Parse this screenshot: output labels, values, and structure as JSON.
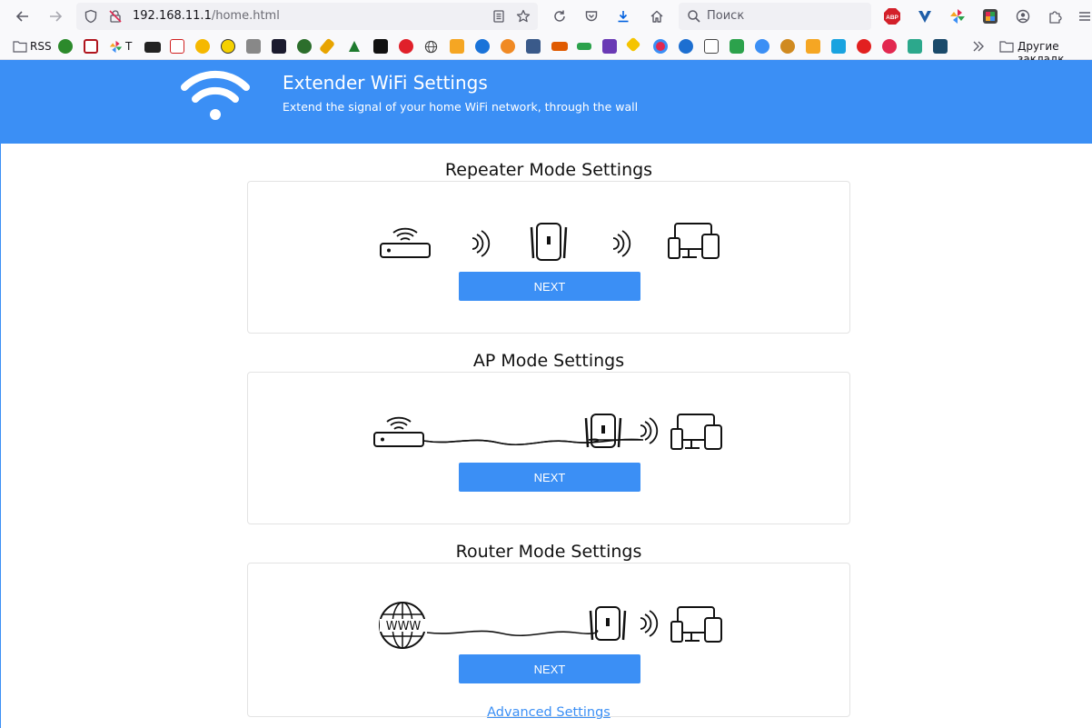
{
  "browser": {
    "url_host": "192.168.11.1",
    "url_path": "/home.html",
    "search_placeholder": "Поиск",
    "bookmarks": {
      "rss_label": "RSS",
      "t_label": "T",
      "other_bookmarks_label": "Другие закладк"
    }
  },
  "banner": {
    "title": "Extender WiFi Settings",
    "subtitle": "Extend the signal of your home WiFi network, through the wall"
  },
  "sections": {
    "repeater": {
      "title": "Repeater Mode Settings",
      "button": "NEXT"
    },
    "ap": {
      "title": "AP Mode Settings",
      "button": "NEXT"
    },
    "router": {
      "title": "Router Mode Settings",
      "button": "NEXT"
    }
  },
  "advanced_link": "Advanced Settings",
  "colors": {
    "accent": "#3b8ff5",
    "white": "#ffffff"
  }
}
